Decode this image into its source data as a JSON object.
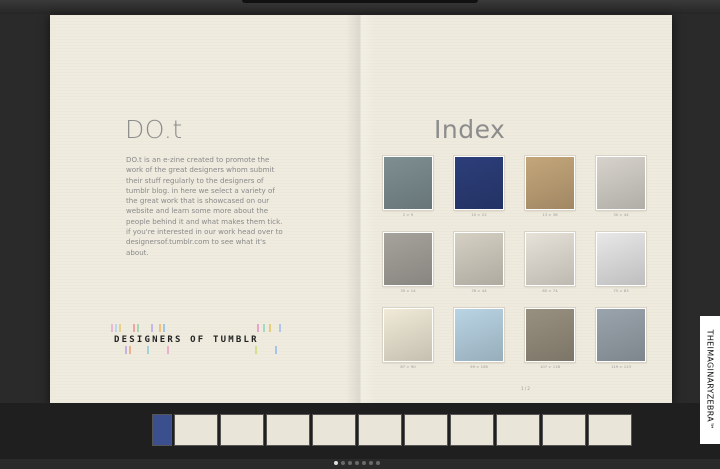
{
  "left_page": {
    "title": "DO.t",
    "intro": "DO.t is an e-zine created to promote the work of the great designers whom submit their stuff regularly to the designers of tumblr blog. in here we select a variety of the great work that is showcased on our website and learn some more about the people behind it and what makes them tick. if you're interested in our work head over to designersof.tumblr.com to see what it's about.",
    "logo_text": "DESIGNERS OF TUMBLR"
  },
  "right_page": {
    "title": "Index",
    "page_number": "1 / 2",
    "items": [
      {
        "caption": "2 > 9",
        "thumb": "man-cap-photo",
        "color": "#7e8f92"
      },
      {
        "caption": "10 > 22",
        "thumb": "blue-abstract",
        "color": "#2c3e7a"
      },
      {
        "caption": "13 > 38",
        "thumb": "girl-hand-face",
        "color": "#c4a67a"
      },
      {
        "caption": "30 > 44",
        "thumb": "treble-clef-sculpture",
        "color": "#d7d3cc"
      },
      {
        "caption": "35 > 14",
        "thumb": "mouse-ears-sphere",
        "color": "#a6a39c"
      },
      {
        "caption": "76 > 44",
        "thumb": "paper-stack",
        "color": "#d5d0c3"
      },
      {
        "caption": "65 > 74",
        "thumb": "stormtrooper-red",
        "color": "#e7e2d8"
      },
      {
        "caption": "75 > 83",
        "thumb": "must-not-stop-type",
        "color": "#e8e8e8"
      },
      {
        "caption": "87 > 90",
        "thumb": "hi-my-name-is-elyse",
        "color": "#f0ead7"
      },
      {
        "caption": "99 > 106",
        "thumb": "cat-illustration",
        "color": "#b9d4e4"
      },
      {
        "caption": "107 > 118",
        "thumb": "floral-dress",
        "color": "#98907f"
      },
      {
        "caption": "119 > 123",
        "thumb": "deer-girl",
        "color": "#9aa4ac"
      }
    ]
  },
  "thumbnail_strip": {
    "count": 11,
    "dots": 7,
    "active_dot": 0
  },
  "badge": {
    "text": "THEIMAGINARYZEBRA™"
  }
}
